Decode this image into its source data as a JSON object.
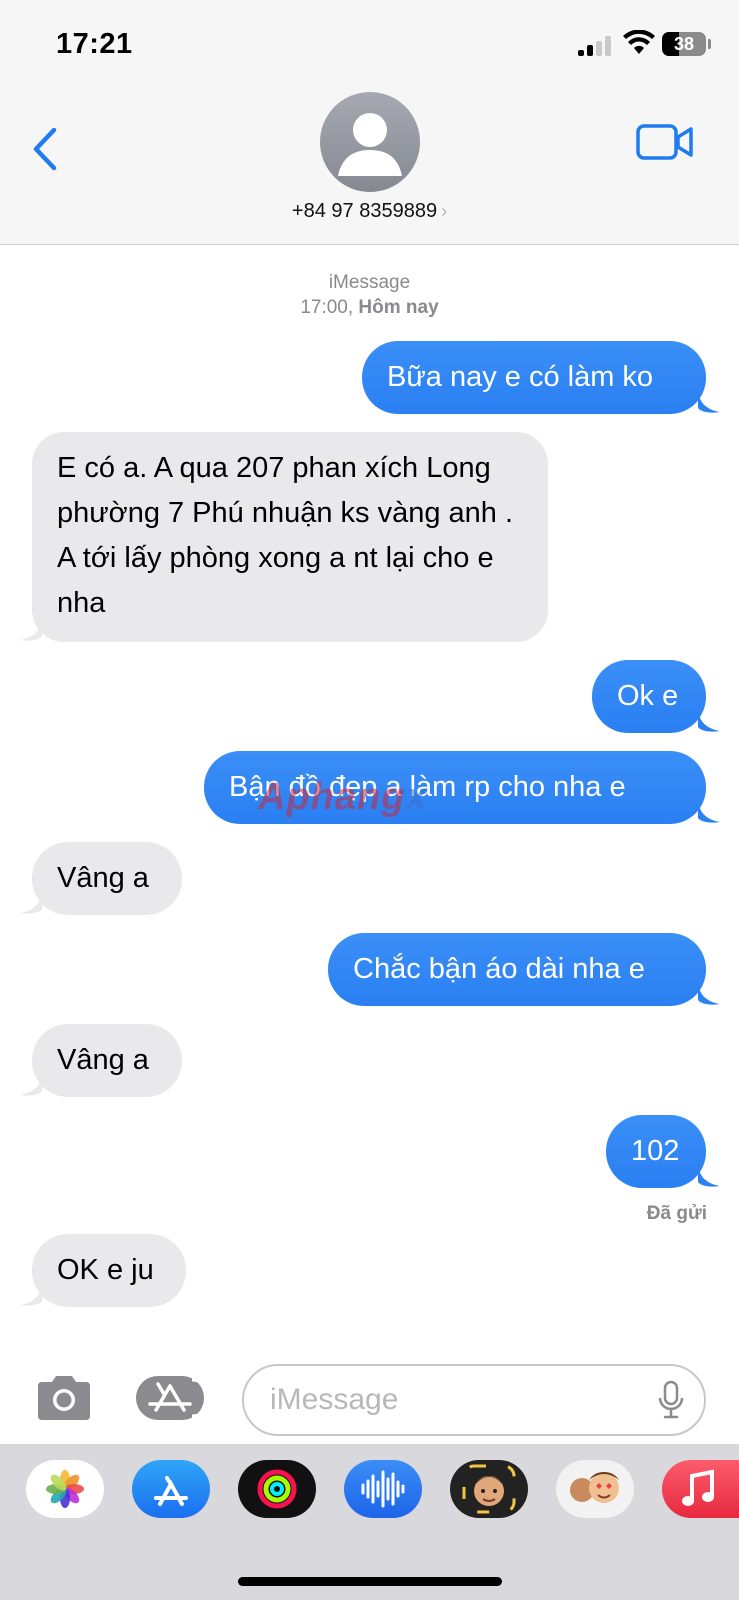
{
  "status": {
    "time": "17:21",
    "battery": "38"
  },
  "header": {
    "contact": "+84 97 8359889"
  },
  "thread": {
    "service": "iMessage",
    "time": "17:00,",
    "day": "Hôm nay",
    "status": "Đã gửi"
  },
  "messages": [
    {
      "dir": "out",
      "text": "Bữa nay e có làm ko"
    },
    {
      "dir": "in",
      "text": "E có a. A qua 207 phan xích Long phường 7 Phú nhuận ks vàng anh . A tới lấy phòng xong a nt lại cho e nha"
    },
    {
      "dir": "out",
      "text": "Ok e"
    },
    {
      "dir": "out",
      "text": "Bận đồ đẹp a làm rp cho nha e"
    },
    {
      "dir": "in",
      "text": "Vâng a"
    },
    {
      "dir": "out",
      "text": "Chắc bận áo dài nha e"
    },
    {
      "dir": "in",
      "text": "Vâng a"
    },
    {
      "dir": "out",
      "text": "102"
    },
    {
      "dir": "in",
      "text": "OK e ju"
    }
  ],
  "watermark": {
    "part1": "Aphang",
    "part2": "x"
  },
  "composer": {
    "placeholder": "iMessage"
  },
  "apps": [
    "photos-icon",
    "app-store-icon",
    "fitness-icon",
    "audio-message-icon",
    "memoji-icon",
    "memoji-stickers-icon",
    "music-icon"
  ],
  "colors": {
    "outgoing": "#2f87f5",
    "incoming": "#e9e9eb",
    "accent": "#1f7cf0"
  }
}
